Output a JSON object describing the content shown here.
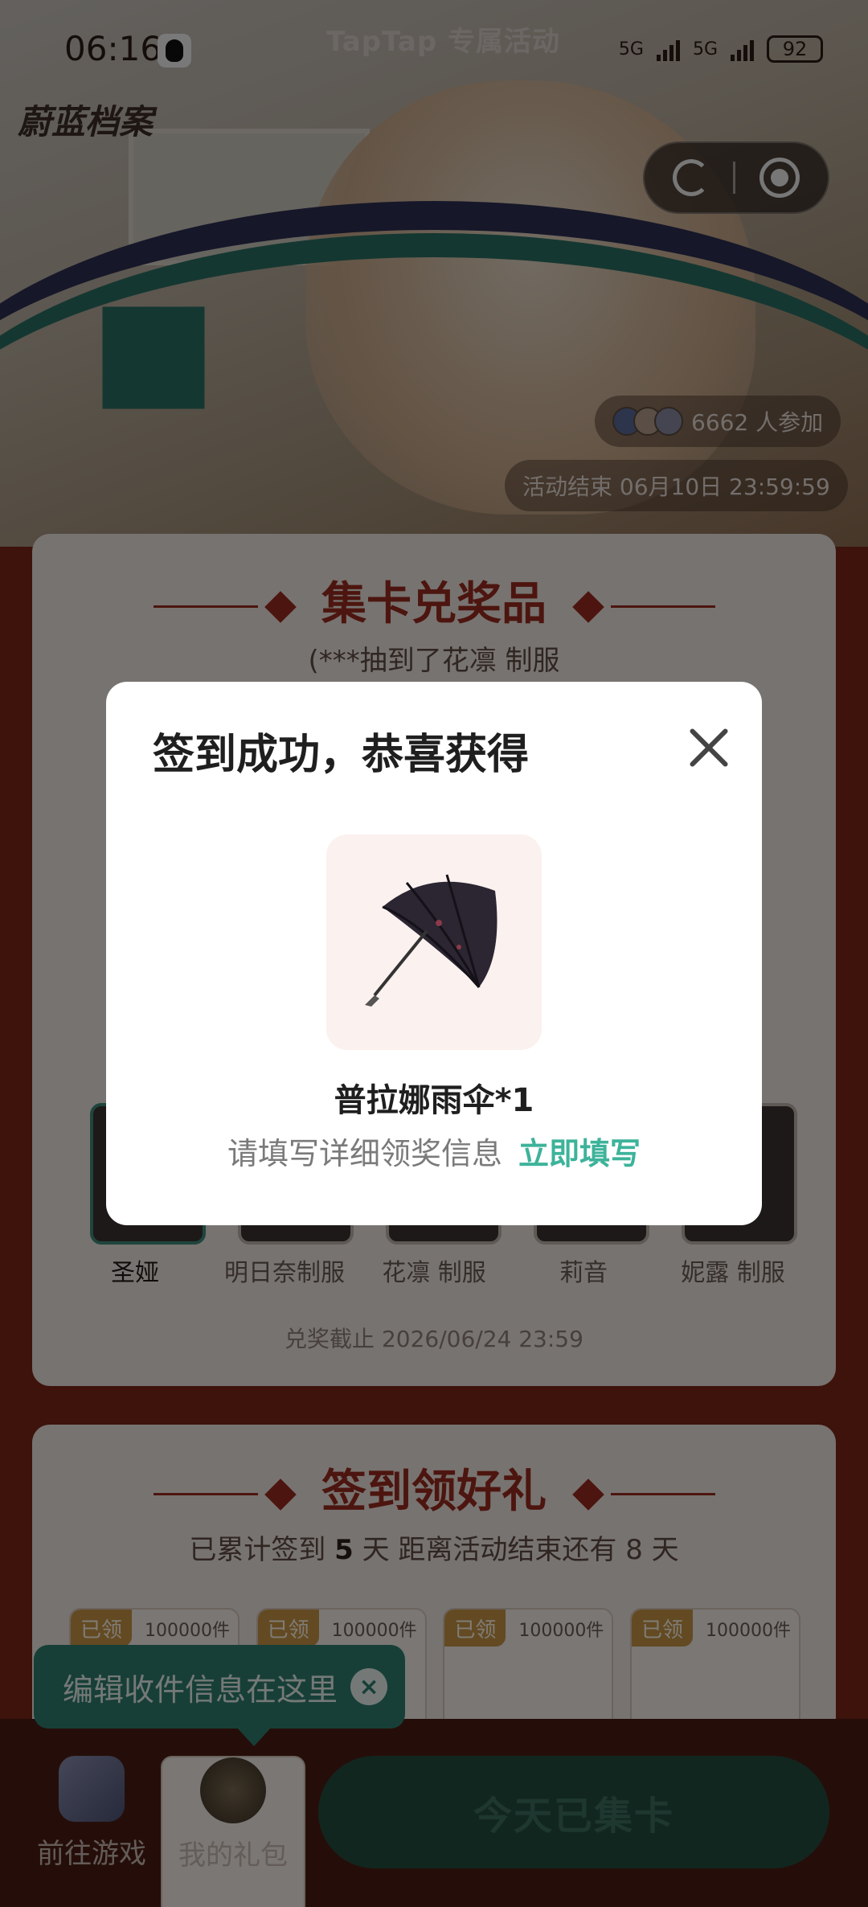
{
  "status_bar": {
    "time": "06:16",
    "app_banner": "TapTap 专属活动",
    "network_1": "5G",
    "network_2": "5G",
    "battery": "92"
  },
  "hero": {
    "game_logo": "蔚蓝档案",
    "participants": "6662 人参加",
    "end_time": "活动结束 06月10日 23:59:59"
  },
  "collect_card": {
    "title": "集卡兑奖品",
    "marquee": "(***抽到了花凛 制服",
    "cards": [
      {
        "label": "圣娅",
        "selected": true
      },
      {
        "label": "明日奈制服",
        "selected": false
      },
      {
        "label": "花凛 制服",
        "selected": false
      },
      {
        "label": "莉音",
        "selected": false
      },
      {
        "label": "妮露 制服",
        "selected": false
      }
    ],
    "deadline": "兑奖截止 2026/06/24 23:59"
  },
  "signin_card": {
    "title": "签到领好礼",
    "streak_prefix": "已累计签到",
    "streak_days": "5",
    "streak_suffix": "天  距离活动结束还有 8 天",
    "gifts": [
      {
        "status": "已领",
        "stock": "100000件"
      },
      {
        "status": "已领",
        "stock": "100000件"
      },
      {
        "status": "已领",
        "stock": "100000件"
      },
      {
        "status": "已领",
        "stock": "100000件"
      }
    ]
  },
  "tooltip": {
    "text": "编辑收件信息在这里",
    "close": "×"
  },
  "bottom_bar": {
    "go_game": "前往游戏",
    "my_gifts": "我的礼包",
    "cta": "今天已集卡"
  },
  "modal": {
    "title": "签到成功，恭喜获得",
    "prize_name": "普拉娜雨伞*1",
    "info_text": "请填写详细领奖信息",
    "fill_link": "立即填写"
  },
  "colors": {
    "accent_green": "#3db39a",
    "brand_red": "#9a2a1e",
    "claimed_gold": "#c79545"
  }
}
